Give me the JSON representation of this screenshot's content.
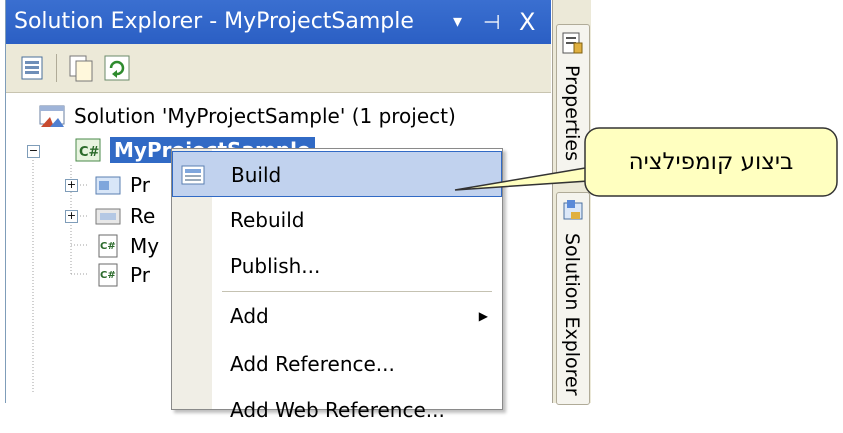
{
  "window": {
    "title": "Solution Explorer - MyProjectSample",
    "controls": {
      "dropdown": "▾",
      "pin": "⊣",
      "close": "X"
    }
  },
  "toolbar": {
    "buttons": [
      {
        "icon": "properties-icon"
      },
      {
        "icon": "show-all-files-icon"
      },
      {
        "icon": "refresh-icon"
      }
    ]
  },
  "tree": {
    "solution_label": "Solution 'MyProjectSample' (1 project)",
    "project_label": "MyProjectSample",
    "items": [
      {
        "label": "Pr",
        "icon": "properties-folder-icon"
      },
      {
        "label": "Re",
        "icon": "references-folder-icon"
      },
      {
        "label": "My",
        "icon": "cs-file-icon"
      },
      {
        "label": "Pr",
        "icon": "cs-file-icon"
      }
    ]
  },
  "side_tabs": {
    "properties": "Properties",
    "solution_explorer": "Solution Explorer"
  },
  "context_menu": {
    "items": [
      {
        "label": "Build",
        "selected": true
      },
      {
        "label": "Rebuild"
      },
      {
        "label": "Publish..."
      },
      {
        "label": "Add",
        "has_submenu": true
      },
      {
        "label": "Add Reference..."
      },
      {
        "label": "Add Web Reference..."
      }
    ]
  },
  "callout": {
    "text": "ביצוע קומפילציה",
    "fill_color": "#ffffc0",
    "stroke_color": "#333333"
  },
  "colors": {
    "title_bar": "#2b5fc4",
    "selection": "#316ac5",
    "menu_highlight": "#c1d2ee"
  }
}
